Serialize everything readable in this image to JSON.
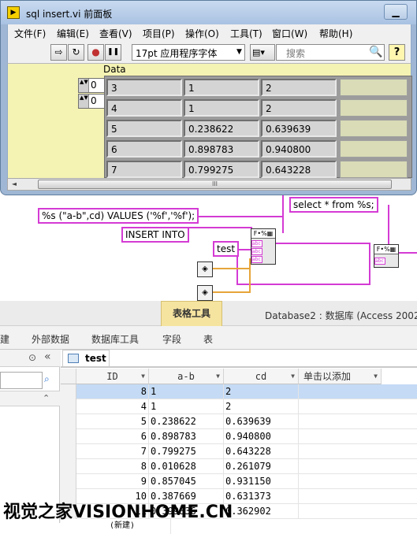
{
  "lv_window": {
    "title": "sql insert.vi 前面板",
    "minimize_glyph": "▁",
    "menu": [
      "文件(F)",
      "编辑(E)",
      "查看(V)",
      "项目(P)",
      "操作(O)",
      "工具(T)",
      "窗口(W)",
      "帮助(H)"
    ],
    "toolbar": {
      "run_arrow_glyph": "⇨",
      "run_continuous_glyph": "↻",
      "abort_glyph": "●",
      "pause_glyph": "❚❚",
      "font_select": "17pt 应用程序字体",
      "font_arrow": "▼",
      "align_glyph": "▤▾",
      "search_placeholder": "搜索",
      "search_icon": "magnifier-icon",
      "search_glyph": "🔍",
      "help_glyph": "?"
    },
    "panel": {
      "array_label": "Data",
      "index_values": [
        "0",
        "0"
      ],
      "spin_glyph": "▲▼",
      "rows": [
        [
          "3",
          "1",
          "2"
        ],
        [
          "4",
          "1",
          "2"
        ],
        [
          "5",
          "0.238622",
          "0.639639"
        ],
        [
          "6",
          "0.898783",
          "0.940800"
        ],
        [
          "7",
          "0.799275",
          "0.643228"
        ]
      ]
    },
    "scrollbar": {
      "left_glyph": "◄",
      "thumb_glyph": "III"
    }
  },
  "diagram": {
    "const_values": "%s (\"a-b\",cd) VALUES ('%f','%f');",
    "const_select": "select * from %s;",
    "const_insert": "INSERT INTO",
    "const_test": "test",
    "node_head": "F•%▦",
    "port_label": "abc",
    "db_glyph": "◈"
  },
  "access": {
    "contextual_tab": "表格工具",
    "title": "Database2 : 数据库 (Access 2002",
    "tabs": [
      "建",
      "外部数据",
      "数据库工具",
      "字段",
      "表"
    ],
    "nav_collapse_glyph": "«",
    "nav_menu_glyph": "⊙",
    "nav_search_glyph": "⌕",
    "nav_group_glyph": "⌃",
    "table_tab": "test",
    "columns": [
      "ID",
      "a-b",
      "cd",
      "单击以添加"
    ],
    "col_arrow": "▼",
    "rows": [
      [
        "8",
        "1",
        "2"
      ],
      [
        "4",
        "1",
        "2"
      ],
      [
        "5",
        "0.238622",
        "0.639639"
      ],
      [
        "6",
        "0.898783",
        "0.940800"
      ],
      [
        "7",
        "0.799275",
        "0.643228"
      ],
      [
        "8",
        "0.010628",
        "0.261079"
      ],
      [
        "9",
        "0.857045",
        "0.931150"
      ],
      [
        "10",
        "0.387669",
        "0.631373"
      ],
      [
        "11",
        "0.399836",
        "0.362902"
      ]
    ],
    "new_row_label": "(新建)"
  },
  "watermark": "视觉之家VISIONHOME.CN",
  "colors": {
    "pink_wire": "#d43bd4",
    "orange_wire": "#e6a53a",
    "lv_panel": "#f5f3b4",
    "selected_row": "#c5dbf5"
  }
}
